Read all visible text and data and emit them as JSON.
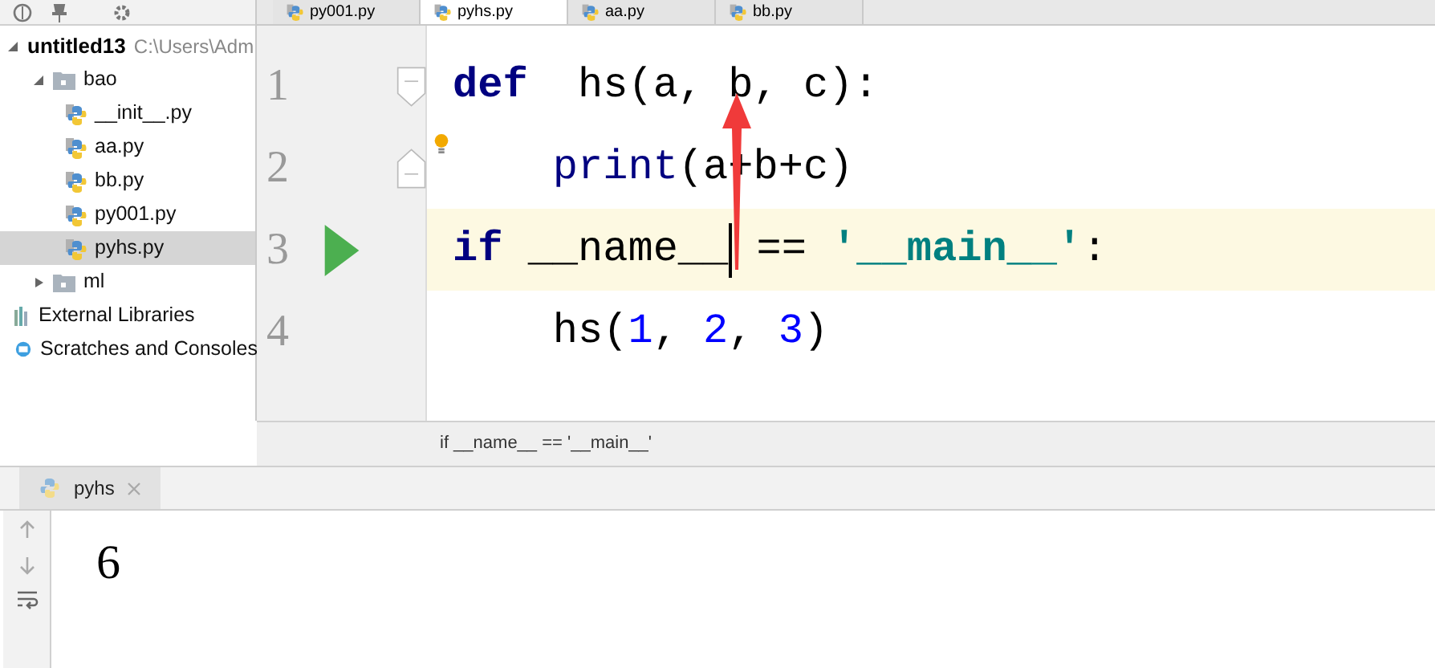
{
  "project": {
    "name": "untitled13",
    "path": "C:\\Users\\Adm",
    "expanded": true,
    "tree": [
      {
        "label": "bao",
        "kind": "folder",
        "expanded": true,
        "selected": false,
        "children": [
          {
            "label": "__init__.py",
            "kind": "python",
            "selected": false
          },
          {
            "label": "aa.py",
            "kind": "python",
            "selected": false
          },
          {
            "label": "bb.py",
            "kind": "python",
            "selected": false
          },
          {
            "label": "py001.py",
            "kind": "python",
            "selected": false
          },
          {
            "label": "pyhs.py",
            "kind": "python",
            "selected": true
          }
        ]
      },
      {
        "label": "ml",
        "kind": "folder",
        "expanded": false,
        "selected": false
      },
      {
        "label": "External Libraries",
        "kind": "libraries",
        "selected": false
      },
      {
        "label": "Scratches and Consoles",
        "kind": "scratches",
        "selected": false
      }
    ]
  },
  "tabs": [
    {
      "label": "py001.py",
      "selected": false
    },
    {
      "label": "pyhs.py",
      "selected": true
    },
    {
      "label": "aa.py",
      "selected": false
    },
    {
      "label": "bb.py",
      "selected": false
    }
  ],
  "editor": {
    "lines": [
      {
        "number": "1",
        "kind": "fold-start",
        "bulb": false,
        "current": false,
        "tokens": [
          {
            "kind": "keyword",
            "text": "def"
          },
          {
            "kind": "plain",
            "text": "  hs(a, b, c):"
          }
        ]
      },
      {
        "number": "2",
        "kind": "fold-end",
        "bulb": true,
        "current": false,
        "tokens": [
          {
            "kind": "builtin",
            "text": "    print"
          },
          {
            "kind": "plain",
            "text": "(a+b+c)"
          }
        ]
      },
      {
        "number": "3",
        "kind": "run",
        "bulb": false,
        "current": true,
        "tokens": [
          {
            "kind": "keyword",
            "text": "if"
          },
          {
            "kind": "plain",
            "text": " __name__"
          },
          {
            "kind": "caret"
          },
          {
            "kind": "plain",
            "text": " == "
          },
          {
            "kind": "string",
            "text": "'__main__'"
          },
          {
            "kind": "plain",
            "text": ":"
          }
        ]
      },
      {
        "number": "4",
        "kind": "plain",
        "bulb": false,
        "current": false,
        "tokens": [
          {
            "kind": "plain",
            "text": "    hs("
          },
          {
            "kind": "number",
            "text": "1"
          },
          {
            "kind": "plain",
            "text": ", "
          },
          {
            "kind": "number",
            "text": "2"
          },
          {
            "kind": "plain",
            "text": ", "
          },
          {
            "kind": "number",
            "text": "3"
          },
          {
            "kind": "plain",
            "text": ")"
          }
        ]
      }
    ],
    "breadcrumb": "if __name__ == '__main__'"
  },
  "run": {
    "tab": "pyhs",
    "output": "6"
  }
}
